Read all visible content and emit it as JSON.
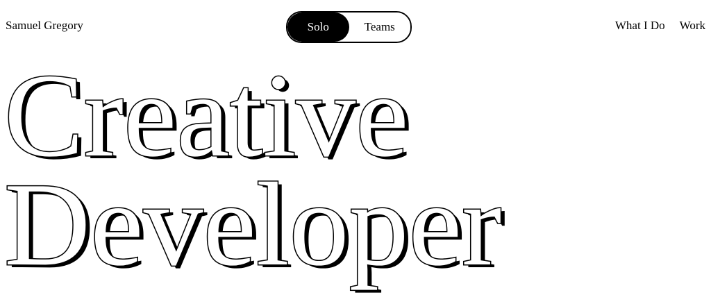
{
  "header": {
    "brand": "Samuel Gregory",
    "mode_toggle": {
      "options": [
        {
          "label": "Solo",
          "selected": true
        },
        {
          "label": "Teams",
          "selected": false
        }
      ]
    },
    "nav": [
      {
        "label": "What I Do"
      },
      {
        "label": "Work"
      }
    ]
  },
  "hero": {
    "line1": "Creative",
    "line2": "Developer"
  },
  "colors": {
    "background": "#ffffff",
    "text": "#000000",
    "toggle_active_bg": "#000000",
    "toggle_active_text": "#ffffff"
  }
}
